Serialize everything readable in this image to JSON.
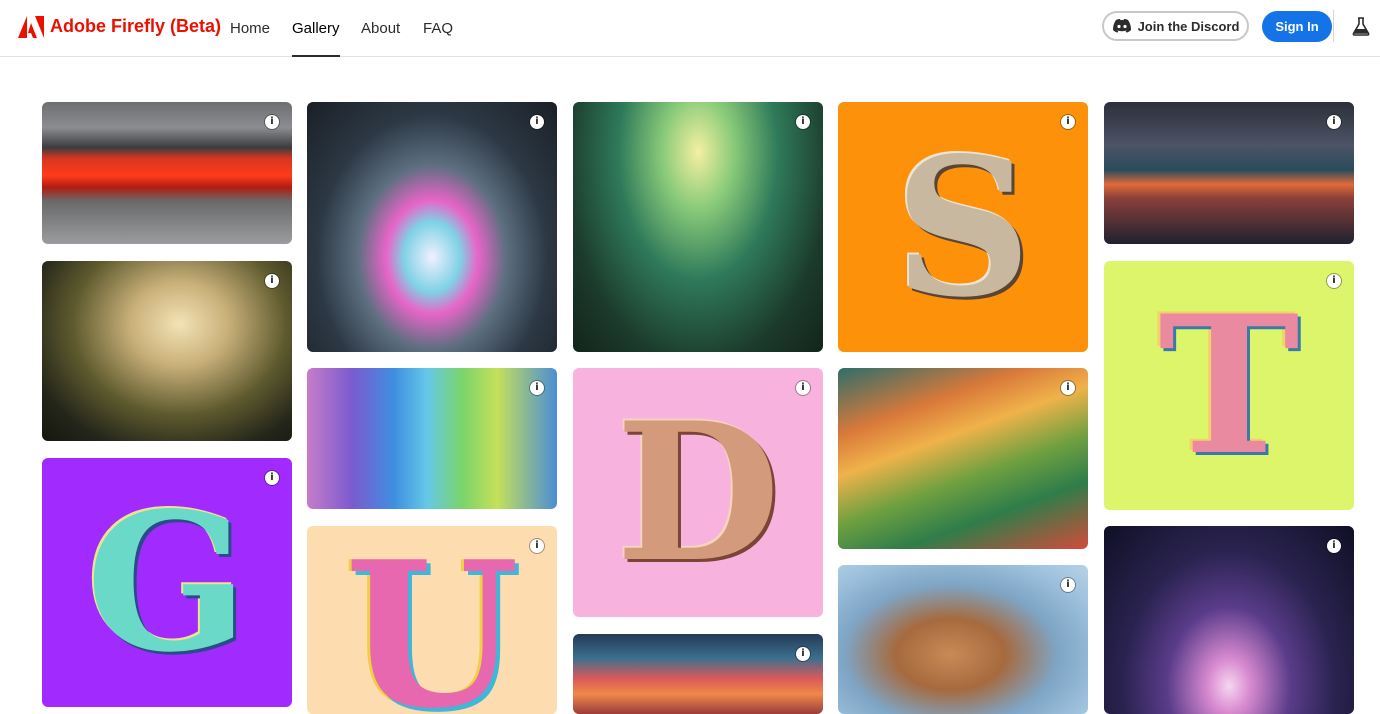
{
  "header": {
    "brand": "Adobe Firefly (Beta)",
    "nav": [
      "Home",
      "Gallery",
      "About",
      "FAQ"
    ],
    "active_nav": "Gallery",
    "discord_label": "Join the Discord",
    "signin_label": "Sign In"
  },
  "gallery": {
    "info_glyph": "i",
    "letters": {
      "s": "S",
      "t": "T",
      "g": "G",
      "d": "D",
      "u": "U"
    }
  },
  "colors": {
    "brand_red": "#eb1000",
    "accent_blue": "#1473e6",
    "tile_orange": "#fd9109",
    "tile_lime": "#dcf56b",
    "tile_purple": "#a12bff",
    "tile_pink": "#f7b3de",
    "tile_peach": "#fddcb0"
  }
}
